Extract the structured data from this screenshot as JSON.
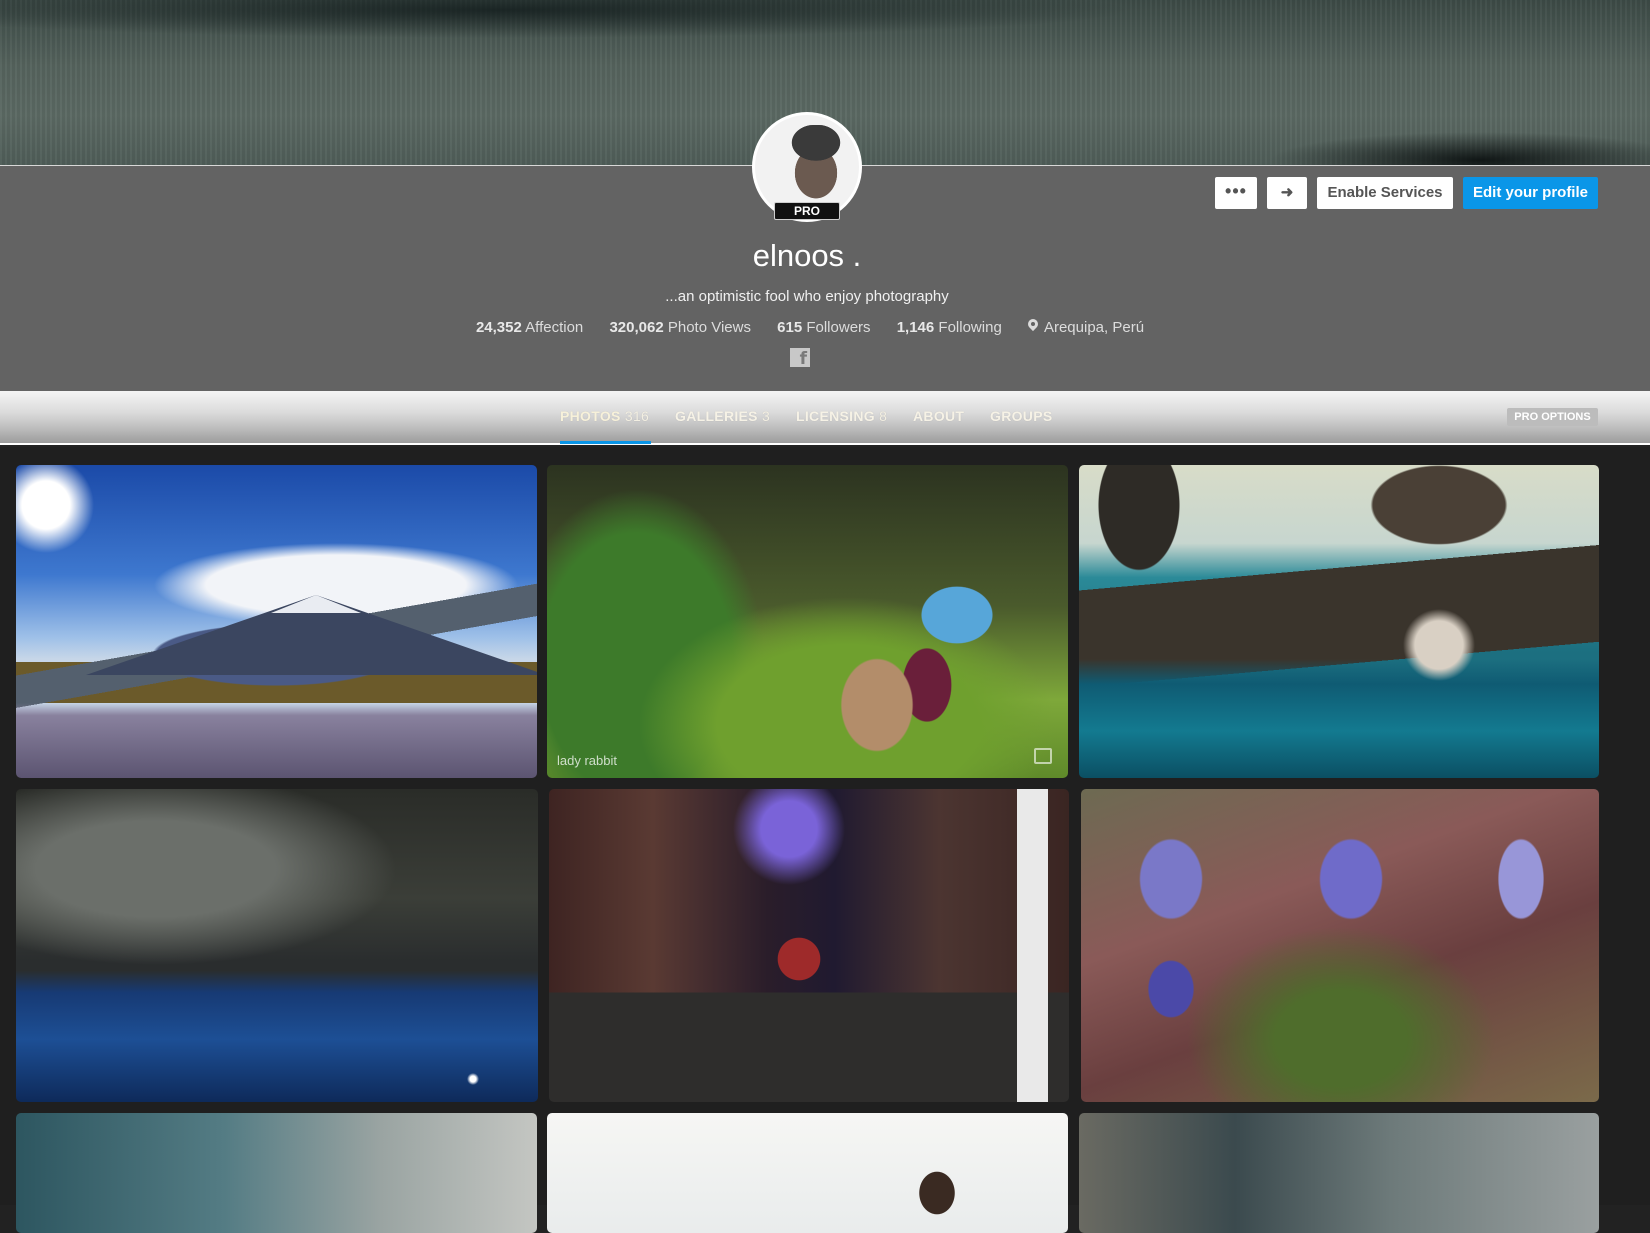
{
  "profile": {
    "badge": "PRO",
    "username": "elnoos .",
    "bio": "...an optimistic fool who enjoy photography",
    "stats": [
      {
        "value": "24,352",
        "label": "Affection"
      },
      {
        "value": "320,062",
        "label": "Photo Views"
      },
      {
        "value": "615",
        "label": "Followers"
      },
      {
        "value": "1,146",
        "label": "Following"
      }
    ],
    "location": "Arequipa, Perú",
    "social": {
      "facebook_glyph": "f"
    }
  },
  "actions": {
    "more": "•••",
    "share": "➜",
    "enable_services": "Enable Services",
    "edit_profile": "Edit your profile"
  },
  "tabs": [
    {
      "label": "PHOTOS",
      "count": "316"
    },
    {
      "label": "GALLERIES",
      "count": "3"
    },
    {
      "label": "LICENSING",
      "count": "8"
    },
    {
      "label": "ABOUT",
      "count": ""
    },
    {
      "label": "GROUPS",
      "count": ""
    }
  ],
  "pro_options": "PRO OPTIONS",
  "photos": [
    {
      "caption": ""
    },
    {
      "caption": "lady rabbit"
    },
    {
      "caption": ""
    },
    {
      "caption": ""
    },
    {
      "caption": ""
    },
    {
      "caption": ""
    },
    {
      "caption": ""
    },
    {
      "caption": ""
    },
    {
      "caption": ""
    }
  ],
  "colors": {
    "accent": "#0a96e8",
    "band": "#636363",
    "background": "#222222"
  },
  "icons": [
    "more-icon",
    "share-arrow-icon",
    "location-pin-icon",
    "facebook-icon",
    "add-to-gallery-icon"
  ]
}
